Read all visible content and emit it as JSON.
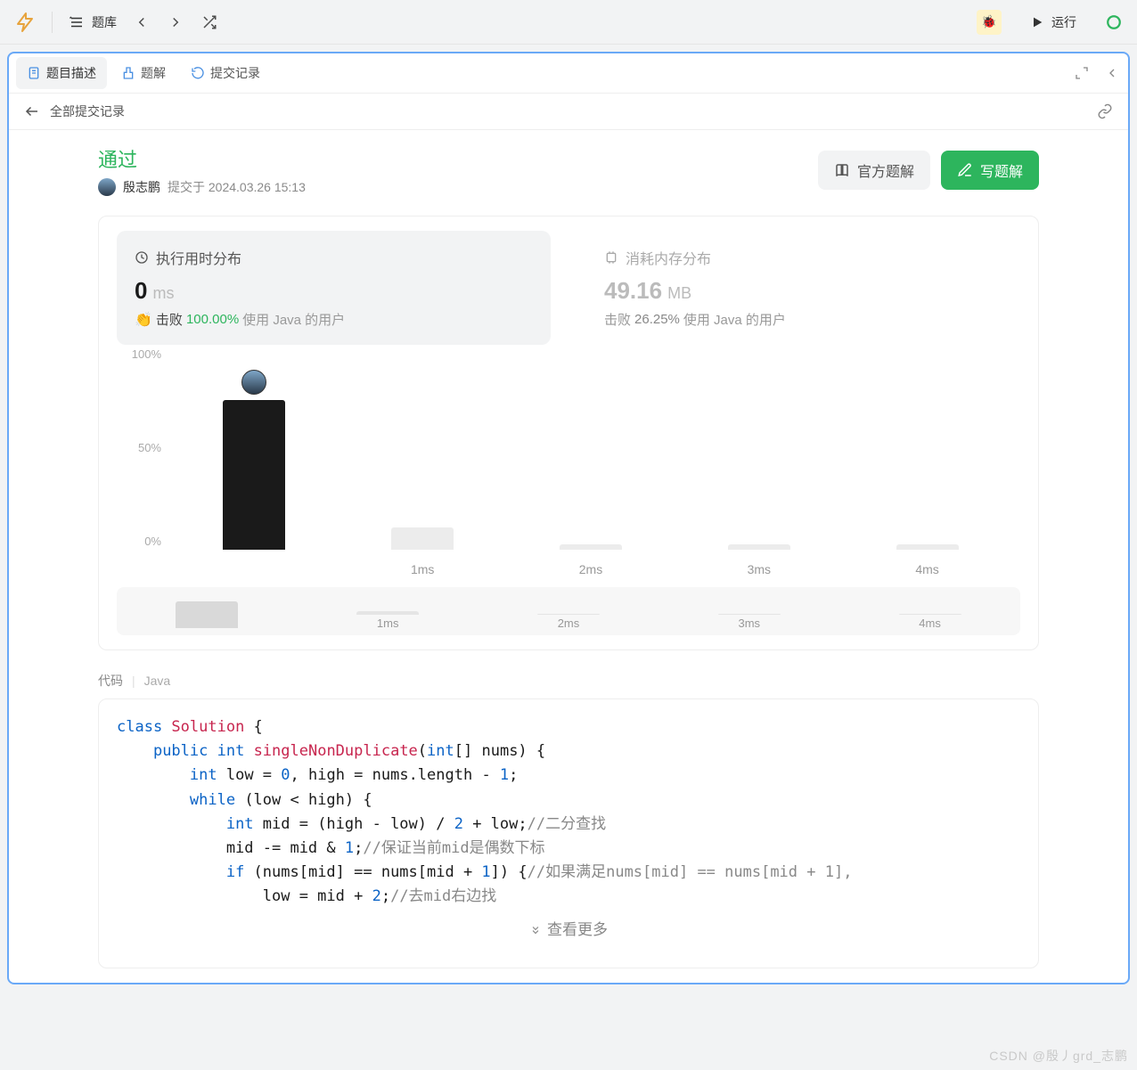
{
  "toolbar": {
    "library_label": "题库",
    "run_label": "运行"
  },
  "tabs": {
    "description": "题目描述",
    "solution": "题解",
    "submissions": "提交记录"
  },
  "subheader": {
    "all_submissions": "全部提交记录"
  },
  "status": {
    "pass_label": "通过",
    "author_name": "殷志鹏",
    "submitted_prefix": "提交于",
    "submitted_at": "2024.03.26 15:13"
  },
  "buttons": {
    "official_solution": "官方题解",
    "write_solution": "写题解"
  },
  "stats": {
    "runtime": {
      "title": "执行用时分布",
      "value": "0",
      "unit": "ms",
      "beats_prefix": "击败",
      "beats_percent": "100.00%",
      "beats_suffix": "使用 Java 的用户"
    },
    "memory": {
      "title": "消耗内存分布",
      "value": "49.16",
      "unit": "MB",
      "beats_prefix": "击败",
      "beats_percent": "26.25%",
      "beats_suffix": "使用 Java 的用户"
    }
  },
  "chart_data": {
    "type": "bar",
    "ylim": [
      0,
      100
    ],
    "yticks": [
      "100%",
      "50%",
      "0%"
    ],
    "categories": [
      "",
      "1ms",
      "2ms",
      "3ms",
      "4ms"
    ],
    "values": [
      80,
      12,
      3,
      3,
      3
    ],
    "highlight_index": 0,
    "minimap": {
      "categories": [
        "",
        "1ms",
        "2ms",
        "3ms",
        "4ms"
      ],
      "values": [
        100,
        15,
        4,
        4,
        4
      ],
      "selected_index": 0
    }
  },
  "code": {
    "header_label": "代码",
    "language": "Java",
    "viewmore_label": "查看更多",
    "tokens": [
      [
        {
          "t": "class ",
          "c": "kw"
        },
        {
          "t": "Solution",
          "c": "cls"
        },
        {
          "t": " {",
          "c": ""
        }
      ],
      [
        {
          "t": "    ",
          "c": ""
        },
        {
          "t": "public ",
          "c": "kw"
        },
        {
          "t": "int ",
          "c": "kw"
        },
        {
          "t": "singleNonDuplicate",
          "c": "fn"
        },
        {
          "t": "(",
          "c": ""
        },
        {
          "t": "int",
          "c": "kw"
        },
        {
          "t": "[]",
          "c": ""
        },
        {
          "t": " nums) {",
          "c": ""
        }
      ],
      [
        {
          "t": "        ",
          "c": ""
        },
        {
          "t": "int",
          "c": "kw"
        },
        {
          "t": " low = ",
          "c": ""
        },
        {
          "t": "0",
          "c": "num"
        },
        {
          "t": ", high = nums.length - ",
          "c": ""
        },
        {
          "t": "1",
          "c": "num"
        },
        {
          "t": ";",
          "c": ""
        }
      ],
      [
        {
          "t": "        ",
          "c": ""
        },
        {
          "t": "while",
          "c": "kw"
        },
        {
          "t": " (low < high) {",
          "c": ""
        }
      ],
      [
        {
          "t": "            ",
          "c": ""
        },
        {
          "t": "int",
          "c": "kw"
        },
        {
          "t": " mid = (high - low) / ",
          "c": ""
        },
        {
          "t": "2",
          "c": "num"
        },
        {
          "t": " + low;",
          "c": ""
        },
        {
          "t": "//二分查找",
          "c": "com"
        }
      ],
      [
        {
          "t": "            mid -= mid & ",
          "c": ""
        },
        {
          "t": "1",
          "c": "num"
        },
        {
          "t": ";",
          "c": ""
        },
        {
          "t": "//保证当前mid是偶数下标",
          "c": "com"
        }
      ],
      [
        {
          "t": "            ",
          "c": ""
        },
        {
          "t": "if",
          "c": "kw"
        },
        {
          "t": " (nums[mid] == nums[mid + ",
          "c": ""
        },
        {
          "t": "1",
          "c": "num"
        },
        {
          "t": "]) {",
          "c": ""
        },
        {
          "t": "//如果满足nums[mid] == nums[mid + 1],",
          "c": "com"
        }
      ],
      [
        {
          "t": "                low = mid + ",
          "c": ""
        },
        {
          "t": "2",
          "c": "num"
        },
        {
          "t": ";",
          "c": ""
        },
        {
          "t": "//去mid右边找",
          "c": "com"
        }
      ]
    ]
  },
  "watermark": "CSDN @殷丿grd_志鹏"
}
